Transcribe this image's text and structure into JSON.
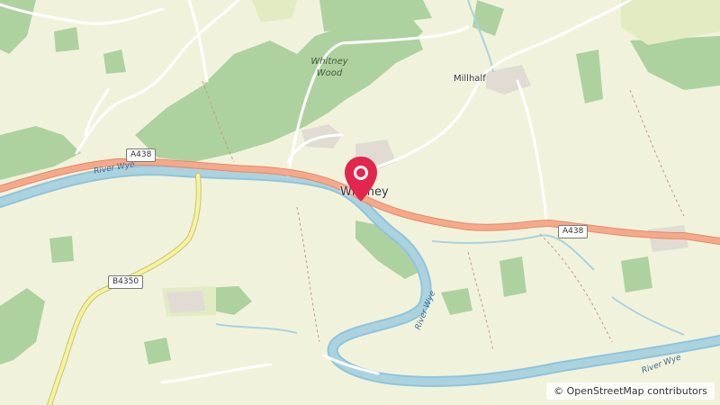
{
  "map": {
    "places": {
      "whitney": "Whitney",
      "millhalf": "Millhalf",
      "whitney_wood": "Whitney Wood"
    },
    "roads": {
      "a438_west": "A438",
      "a438_east": "A438",
      "b4350": "B4350"
    },
    "rivers": {
      "wye_west": "River Wye",
      "wye_middle": "River Wye",
      "wye_south": "River Wye"
    },
    "attribution": "© OpenStreetMap contributors",
    "marker_icon": "map-pin-icon",
    "colors": {
      "land": "#f1f2dc",
      "forest": "#aed1a0",
      "water": "#aad3df",
      "river": "#8fc4dc",
      "road_a": "#f6a98a",
      "road_b": "#f7f2a0",
      "marker": "#e2264d"
    }
  }
}
